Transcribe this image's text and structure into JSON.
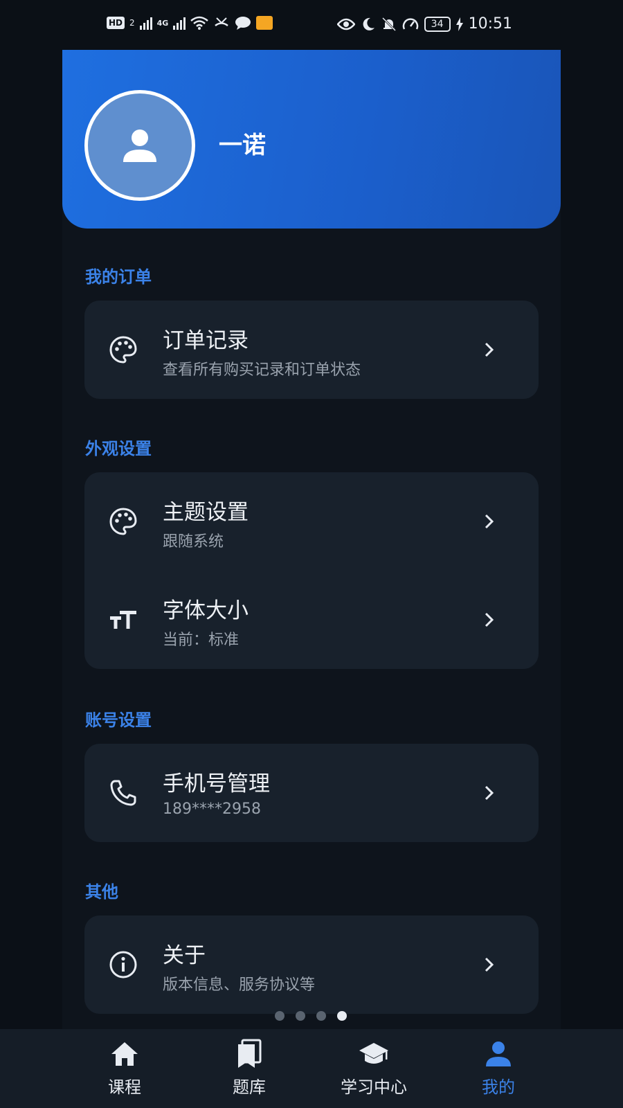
{
  "status_bar": {
    "hd_badge": "HD",
    "hd_sub": "2",
    "network": "4G",
    "battery": "34",
    "time": "10:51"
  },
  "profile": {
    "username": "一诺"
  },
  "sections": [
    {
      "title": "我的订单",
      "items": [
        {
          "title": "订单记录",
          "subtitle": "查看所有购买记录和订单状态",
          "icon": "palette-icon"
        }
      ]
    },
    {
      "title": "外观设置",
      "items": [
        {
          "title": "主题设置",
          "subtitle": "跟随系统",
          "icon": "palette-icon"
        },
        {
          "title": "字体大小",
          "subtitle": "当前：标准",
          "icon": "text-size-icon"
        }
      ]
    },
    {
      "title": "账号设置",
      "items": [
        {
          "title": "手机号管理",
          "subtitle": "189****2958",
          "icon": "phone-icon"
        }
      ]
    },
    {
      "title": "其他",
      "items": [
        {
          "title": "关于",
          "subtitle": "版本信息、服务协议等",
          "icon": "info-icon"
        }
      ]
    }
  ],
  "page_indicator": {
    "count": 4,
    "active_index": 3
  },
  "bottom_nav": [
    {
      "label": "课程",
      "icon": "home-icon",
      "active": false
    },
    {
      "label": "题库",
      "icon": "books-icon",
      "active": false
    },
    {
      "label": "学习中心",
      "icon": "graduation-cap-icon",
      "active": false
    },
    {
      "label": "我的",
      "icon": "person-icon",
      "active": true
    }
  ],
  "colors": {
    "accent": "#3b82e8",
    "header_blue": "#1f6fe0",
    "background": "#0e141c",
    "card": "#18212c"
  }
}
